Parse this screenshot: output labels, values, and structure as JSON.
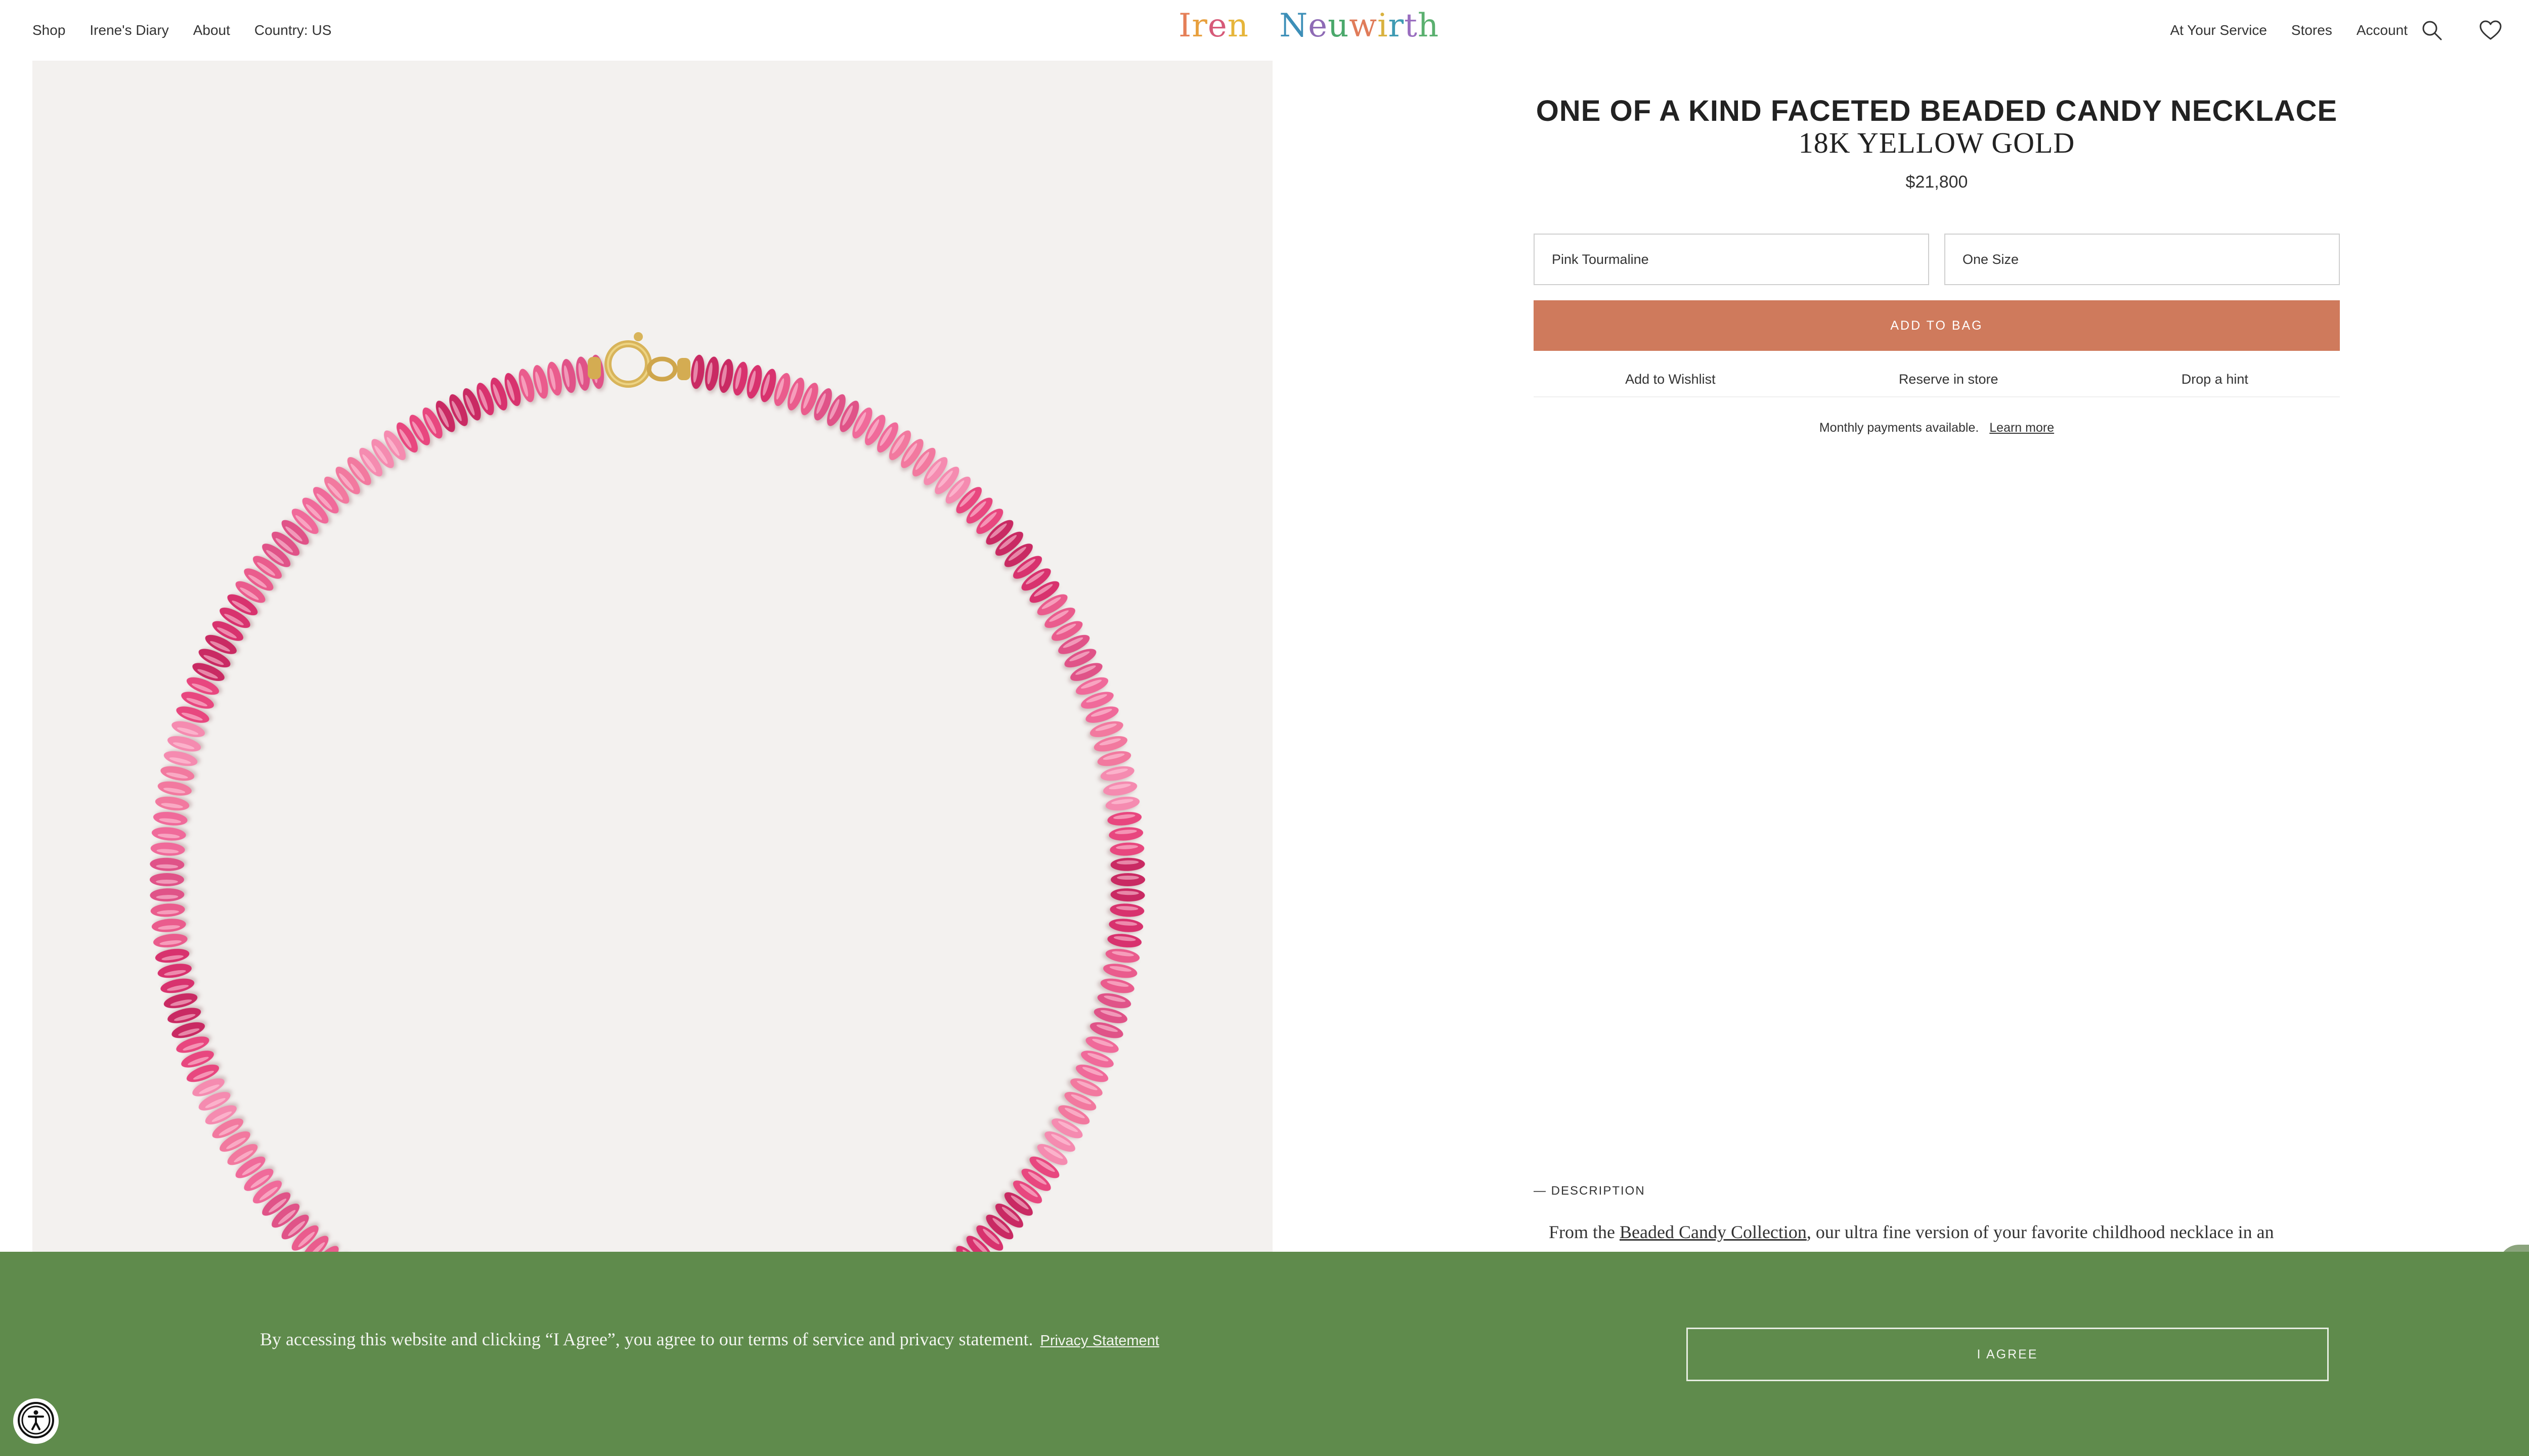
{
  "header": {
    "nav_left": [
      "Shop",
      "Irene's Diary",
      "About",
      "Country: US"
    ],
    "logo": "Irene Neuwirth",
    "logo_colors": [
      "#e57f57",
      "#e8a03e",
      "#d65a78",
      "#e6b53a",
      "#ffffff",
      "#2f9a8a",
      "#3d8fb8",
      "#8e6bb5",
      "#4aa86b",
      "#e07c5a",
      "#d9b23f",
      "#3f9bb3",
      "#9a6fc0",
      "#5ab06f"
    ],
    "nav_right": [
      "At Your Service",
      "Stores",
      "Account"
    ],
    "icons": [
      "search-icon",
      "heart-icon",
      "shopping-bag-icon"
    ]
  },
  "product": {
    "title_line1": "ONE OF A KIND FACETED BEADED CANDY NECKLACE",
    "title_line2": "18K YELLOW GOLD",
    "price": "$21,800",
    "stone_option": "Pink Tourmaline",
    "size_option": "One Size",
    "add_to_bag": "ADD TO BAG",
    "actions": [
      "Add to Wishlist",
      "Reserve in store",
      "Drop a hint"
    ],
    "payments_text": "Monthly payments available.",
    "learn_more": "Learn more",
    "description_heading": "— DESCRIPTION",
    "description_prefix": "From the ",
    "description_link": "Beaded Candy Collection",
    "description_suffix": ", our ultra fine version of your favorite childhood necklace in an"
  },
  "consent": {
    "text": "By accessing this website and clicking “I Agree”, you agree to our terms of service and privacy statement.",
    "privacy_link": "Privacy Statement",
    "agree_button": "I AGREE"
  },
  "colors": {
    "accent_button": "#cf7a5c",
    "consent_bg": "#5f8b4c",
    "image_bg": "#f3f1ef",
    "bead_pink": "#e8477f",
    "clasp_gold": "#d8b45a"
  }
}
